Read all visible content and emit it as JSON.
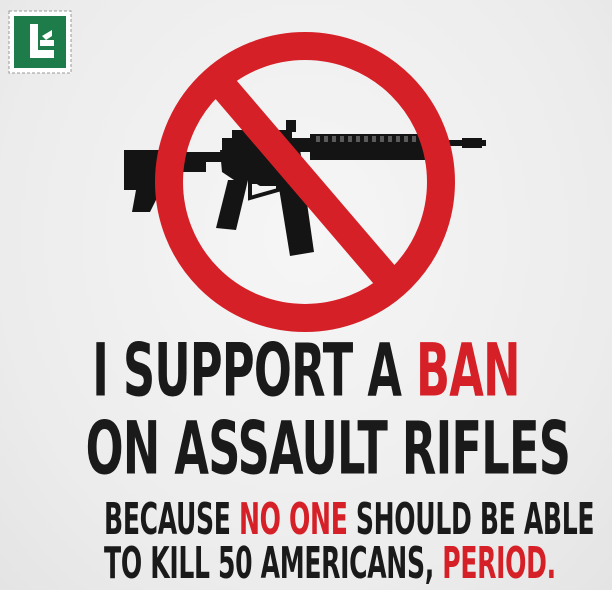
{
  "headline": {
    "line1_prefix": "I SUPPORT A ",
    "line1_highlight": "BAN",
    "line2": "ON ASSAULT RIFLES",
    "line3_prefix": "BECAUSE ",
    "line3_highlight": "NO ONE",
    "line3_suffix": " SHOULD BE ABLE",
    "line4_prefix": "TO KILL 50 AMERICANS, ",
    "line4_highlight": "PERIOD."
  },
  "icons": {
    "logo": "stamp-logo-icon",
    "sign": "no-symbol-icon",
    "rifle": "assault-rifle-icon"
  },
  "colors": {
    "accent_red": "#d62027",
    "text_dark": "#1a1a1a",
    "logo_green": "#1e7b4a",
    "background": "#efefef"
  }
}
